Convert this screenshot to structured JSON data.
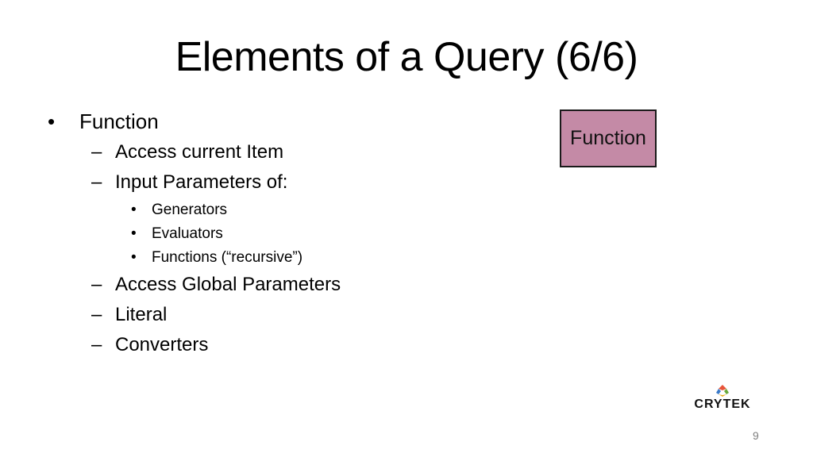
{
  "slide": {
    "title": "Elements of a Query (6/6)",
    "bullets": [
      {
        "text": "Function",
        "marker": "•",
        "children": [
          {
            "text": "Access current Item",
            "marker": "–"
          },
          {
            "text": "Input Parameters of:",
            "marker": "–",
            "children": [
              {
                "text": "Generators",
                "marker": "•"
              },
              {
                "text": "Evaluators",
                "marker": "•"
              },
              {
                "text": "Functions (“recursive”)",
                "marker": "•"
              }
            ]
          },
          {
            "text": "Access Global Parameters",
            "marker": "–"
          },
          {
            "text": "Literal",
            "marker": "–"
          },
          {
            "text": "Converters",
            "marker": "–"
          }
        ]
      }
    ],
    "diagram_box": {
      "label": "Function",
      "fill_color": "#c48aa6",
      "border_color": "#1a1a1a"
    },
    "logo": {
      "text": "CRYTEK",
      "icon": "crytek-diamond-logo"
    },
    "page_number": "9"
  }
}
